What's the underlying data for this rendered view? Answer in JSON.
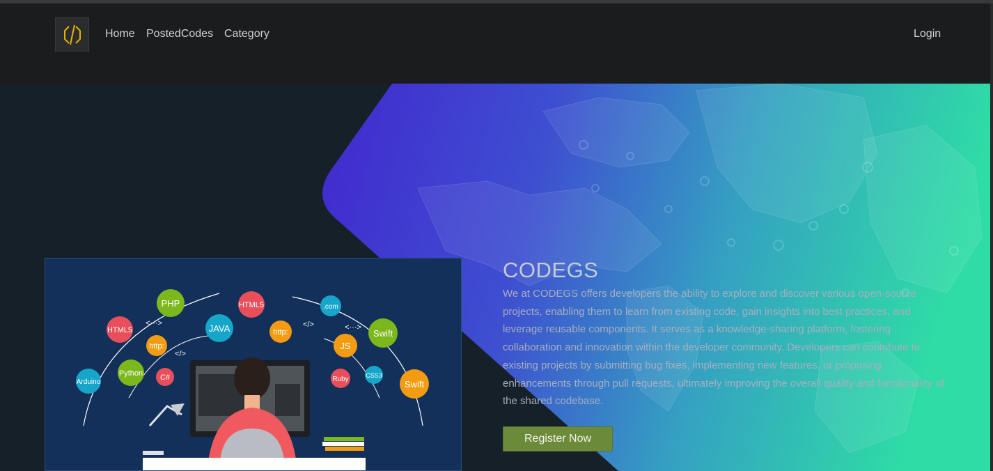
{
  "nav": {
    "brand_icon": "code-brackets-icon",
    "links": [
      "Home",
      "PostedCodes",
      "Category"
    ],
    "login_label": "Login"
  },
  "hero": {
    "title": "CODEGS",
    "description": "We at CODEGS offers developers the ability to explore and discover various open-source projects, enabling them to learn from existing code, gain insights into best practices, and leverage reusable components. It serves as a knowledge-sharing platform, fostering collaboration and innovation within the developer community. Developers can contribute to existing projects by submitting bug fixes, implementing new features, or proposing enhancements through pull requests, ultimately improving the overall quality and functionality of the shared codebase.",
    "register_label": "Register Now"
  },
  "illustration": {
    "bubbles": [
      "PHP",
      "HTML5",
      ".com",
      "HTML5",
      "JAVA",
      "http:",
      "Swift",
      "http:",
      "JS",
      "Arduino",
      "Python",
      "C#",
      "Ruby",
      "CSS3",
      "Swift"
    ],
    "symbols": [
      "</>",
      "</>",
      "<···>",
      "<···>",
      "</>"
    ]
  },
  "colors": {
    "nav_bg": "#1b1c1e",
    "hero_dark": "#152028",
    "gradient_start": "#3f2fd0",
    "gradient_end": "#2fd9a5",
    "accent_button": "#6c8b3a",
    "logo_icon": "#e8b300"
  }
}
